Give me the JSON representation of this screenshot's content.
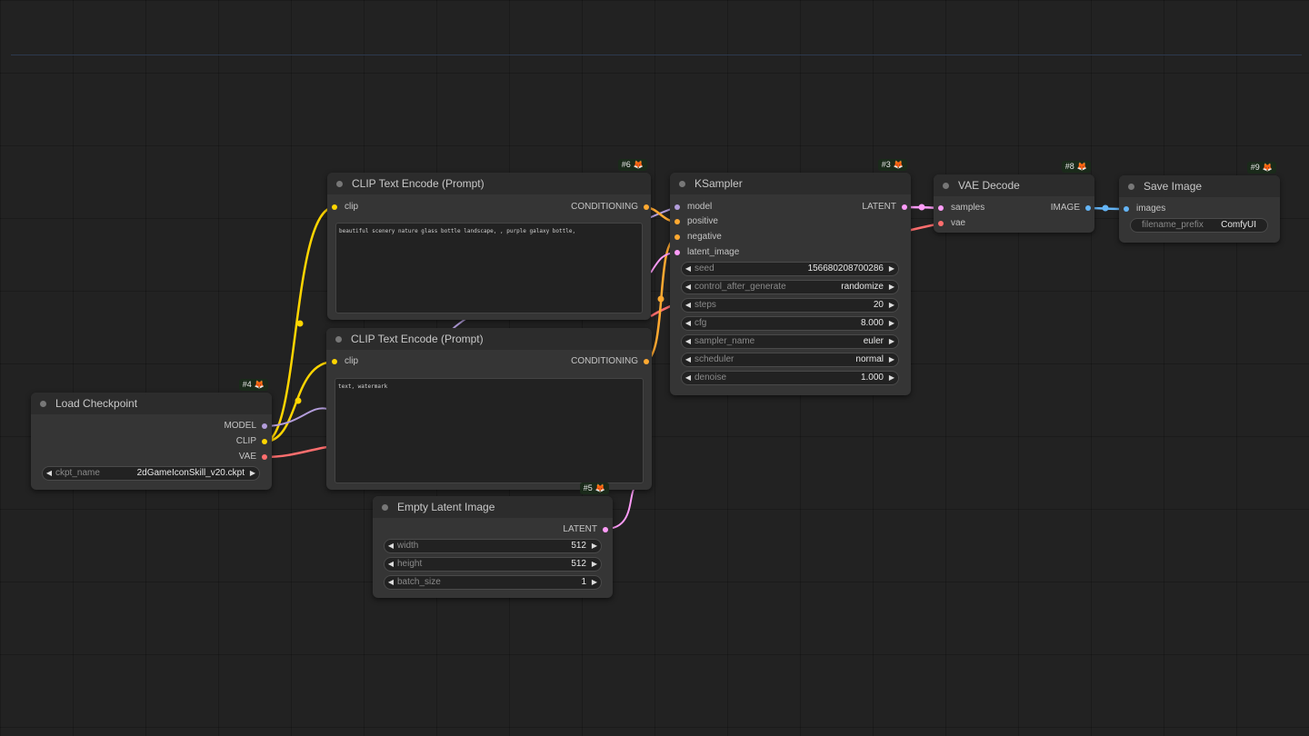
{
  "colors": {
    "clip": "#ffd500",
    "conditioning": "#ffa931",
    "model": "#b39ddb",
    "latent": "#ff9cf9",
    "vae": "#ff6e6e",
    "image": "#64b5f6"
  },
  "nodes": {
    "clip_pos": {
      "id": "#6",
      "title": "CLIP Text Encode (Prompt)",
      "input": "clip",
      "output": "CONDITIONING",
      "text": "beautiful scenery nature glass bottle landscape, , purple galaxy bottle,"
    },
    "clip_neg": {
      "id": "#7",
      "title": "CLIP Text Encode (Prompt)",
      "input": "clip",
      "output": "CONDITIONING",
      "text": "text, watermark"
    },
    "ksampler": {
      "id": "#3",
      "title": "KSampler",
      "inputs": [
        "model",
        "positive",
        "negative",
        "latent_image"
      ],
      "output": "LATENT",
      "widgets": [
        {
          "name": "seed",
          "value": "156680208700286"
        },
        {
          "name": "control_after_generate",
          "value": "randomize"
        },
        {
          "name": "steps",
          "value": "20"
        },
        {
          "name": "cfg",
          "value": "8.000"
        },
        {
          "name": "sampler_name",
          "value": "euler"
        },
        {
          "name": "scheduler",
          "value": "normal"
        },
        {
          "name": "denoise",
          "value": "1.000"
        }
      ]
    },
    "vae_decode": {
      "id": "#8",
      "title": "VAE Decode",
      "inputs": [
        "samples",
        "vae"
      ],
      "output": "IMAGE"
    },
    "save_image": {
      "id": "#9",
      "title": "Save Image",
      "input": "images",
      "widget": {
        "name": "filename_prefix",
        "value": "ComfyUI"
      }
    },
    "load_checkpoint": {
      "id": "#4",
      "title": "Load Checkpoint",
      "outputs": [
        "MODEL",
        "CLIP",
        "VAE"
      ],
      "widget": {
        "name": "ckpt_name",
        "value": "2dGameIconSkill_v20.ckpt"
      }
    },
    "empty_latent": {
      "id": "#5",
      "title": "Empty Latent Image",
      "output": "LATENT",
      "widgets": [
        {
          "name": "width",
          "value": "512"
        },
        {
          "name": "height",
          "value": "512"
        },
        {
          "name": "batch_size",
          "value": "1"
        }
      ]
    }
  }
}
